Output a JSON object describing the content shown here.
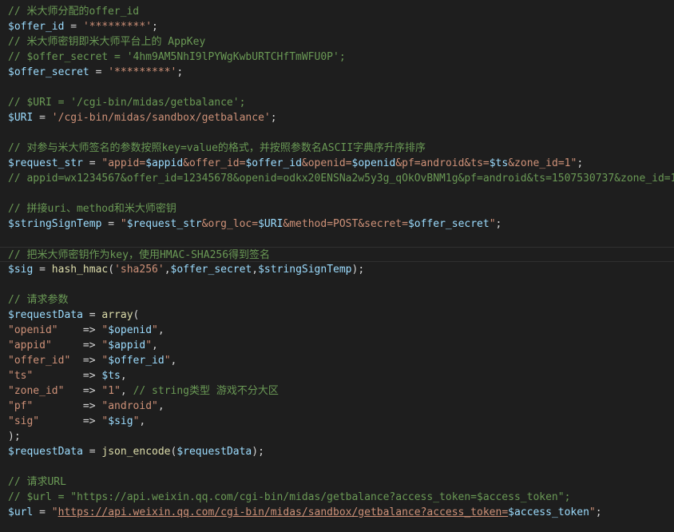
{
  "editor": {
    "theme_colors": {
      "background": "#1e1e1e",
      "comment": "#6a9955",
      "variable": "#9cdcfe",
      "string": "#ce9178",
      "function": "#dcdcaa",
      "default": "#d4d4d4"
    },
    "current_line_index": 16,
    "lines": [
      [
        [
          "comment",
          "// 米大师分配的offer_id"
        ]
      ],
      [
        [
          "var",
          "$offer_id"
        ],
        [
          "op",
          " = "
        ],
        [
          "str",
          "'*********'"
        ],
        [
          "punc",
          ";"
        ]
      ],
      [
        [
          "comment",
          "// 米大师密钥即米大师平台上的 AppKey"
        ]
      ],
      [
        [
          "comment",
          "// $offer_secret = '4hm9AM5NhI9lPYWgKwbURTCHfTmWFU0P';"
        ]
      ],
      [
        [
          "var",
          "$offer_secret"
        ],
        [
          "op",
          " = "
        ],
        [
          "str",
          "'*********'"
        ],
        [
          "punc",
          ";"
        ]
      ],
      [],
      [
        [
          "comment",
          "// $URI = '/cgi-bin/midas/getbalance';"
        ]
      ],
      [
        [
          "var",
          "$URI"
        ],
        [
          "op",
          " = "
        ],
        [
          "str",
          "'/cgi-bin/midas/sandbox/getbalance'"
        ],
        [
          "punc",
          ";"
        ]
      ],
      [],
      [
        [
          "comment",
          "// 对参与米大师签名的参数按照key=value的格式，并按照参数名ASCII字典序升序排序"
        ]
      ],
      [
        [
          "var",
          "$request_str"
        ],
        [
          "op",
          " = "
        ],
        [
          "str",
          "\"appid="
        ],
        [
          "var",
          "$appid"
        ],
        [
          "str",
          "&offer_id="
        ],
        [
          "var",
          "$offer_id"
        ],
        [
          "str",
          "&openid="
        ],
        [
          "var",
          "$openid"
        ],
        [
          "str",
          "&pf=android&ts="
        ],
        [
          "var",
          "$ts"
        ],
        [
          "str",
          "&zone_id=1\""
        ],
        [
          "punc",
          ";"
        ]
      ],
      [
        [
          "comment",
          "// appid=wx1234567&offer_id=12345678&openid=odkx20ENSNa2w5y3g_qOkOvBNM1g&pf=android&ts=1507530737&zone_id=1"
        ]
      ],
      [],
      [
        [
          "comment",
          "// 拼接uri、method和米大师密钥"
        ]
      ],
      [
        [
          "var",
          "$stringSignTemp"
        ],
        [
          "op",
          " = "
        ],
        [
          "str",
          "\""
        ],
        [
          "var",
          "$request_str"
        ],
        [
          "str",
          "&org_loc="
        ],
        [
          "var",
          "$URI"
        ],
        [
          "str",
          "&method=POST&secret="
        ],
        [
          "var",
          "$offer_secret"
        ],
        [
          "str",
          "\""
        ],
        [
          "punc",
          ";"
        ]
      ],
      [],
      [
        [
          "comment",
          "// 把米大师密钥作为key，使用HMAC-SHA256得到签名"
        ]
      ],
      [
        [
          "var",
          "$sig"
        ],
        [
          "op",
          " = "
        ],
        [
          "func",
          "hash_hmac"
        ],
        [
          "punc",
          "("
        ],
        [
          "str",
          "'sha256'"
        ],
        [
          "punc",
          ","
        ],
        [
          "var",
          "$offer_secret"
        ],
        [
          "punc",
          ","
        ],
        [
          "var",
          "$stringSignTemp"
        ],
        [
          "punc",
          ");"
        ]
      ],
      [],
      [
        [
          "comment",
          "// 请求参数"
        ]
      ],
      [
        [
          "var",
          "$requestData"
        ],
        [
          "op",
          " = "
        ],
        [
          "func",
          "array"
        ],
        [
          "punc",
          "("
        ]
      ],
      [
        [
          "str",
          "\"openid\""
        ],
        [
          "op",
          "    => "
        ],
        [
          "str",
          "\""
        ],
        [
          "var",
          "$openid"
        ],
        [
          "str",
          "\""
        ],
        [
          "punc",
          ","
        ]
      ],
      [
        [
          "str",
          "\"appid\""
        ],
        [
          "op",
          "     => "
        ],
        [
          "str",
          "\""
        ],
        [
          "var",
          "$appid"
        ],
        [
          "str",
          "\""
        ],
        [
          "punc",
          ","
        ]
      ],
      [
        [
          "str",
          "\"offer_id\""
        ],
        [
          "op",
          "  => "
        ],
        [
          "str",
          "\""
        ],
        [
          "var",
          "$offer_id"
        ],
        [
          "str",
          "\""
        ],
        [
          "punc",
          ","
        ]
      ],
      [
        [
          "str",
          "\"ts\""
        ],
        [
          "op",
          "        => "
        ],
        [
          "var",
          "$ts"
        ],
        [
          "punc",
          ","
        ]
      ],
      [
        [
          "str",
          "\"zone_id\""
        ],
        [
          "op",
          "   => "
        ],
        [
          "str",
          "\"1\""
        ],
        [
          "punc",
          ", "
        ],
        [
          "comment",
          "// string类型 游戏不分大区"
        ]
      ],
      [
        [
          "str",
          "\"pf\""
        ],
        [
          "op",
          "        => "
        ],
        [
          "str",
          "\"android\""
        ],
        [
          "punc",
          ","
        ]
      ],
      [
        [
          "str",
          "\"sig\""
        ],
        [
          "op",
          "       => "
        ],
        [
          "str",
          "\""
        ],
        [
          "var",
          "$sig"
        ],
        [
          "str",
          "\""
        ],
        [
          "punc",
          ","
        ]
      ],
      [
        [
          "punc",
          ");"
        ]
      ],
      [
        [
          "var",
          "$requestData"
        ],
        [
          "op",
          " = "
        ],
        [
          "func",
          "json_encode"
        ],
        [
          "punc",
          "("
        ],
        [
          "var",
          "$requestData"
        ],
        [
          "punc",
          ");"
        ]
      ],
      [],
      [
        [
          "comment",
          "// 请求URL"
        ]
      ],
      [
        [
          "comment",
          "// $url = \"https://api.weixin.qq.com/cgi-bin/midas/getbalance?access_token=$access_token\";"
        ]
      ],
      [
        [
          "var",
          "$url"
        ],
        [
          "op",
          " = "
        ],
        [
          "str",
          "\""
        ],
        [
          "link",
          "https://api.weixin.qq.com/cgi-bin/midas/sandbox/getbalance?access_token="
        ],
        [
          "var",
          "$access_token"
        ],
        [
          "str",
          "\""
        ],
        [
          "punc",
          ";"
        ]
      ]
    ]
  }
}
